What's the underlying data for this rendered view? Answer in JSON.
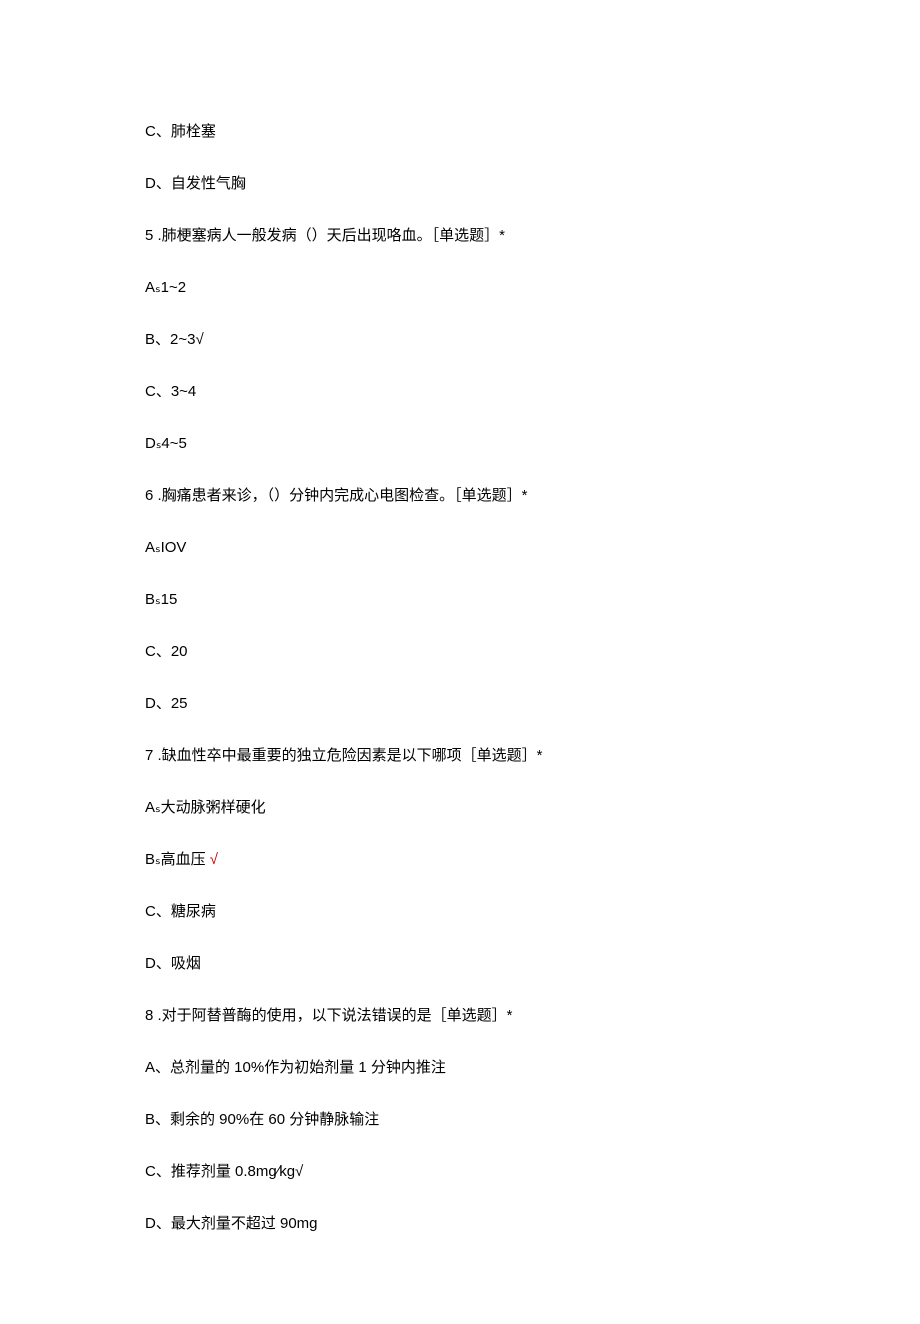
{
  "lines": {
    "optC4": "C、肺栓塞",
    "optD4": "D、自发性气胸",
    "q5": "5 .肺梗塞病人一般发病（）天后出现咯血。［单选题］*",
    "q5a": "Aₛ1~2",
    "q5b": "B、2~3√",
    "q5c": "C、3~4",
    "q5d": "Dₛ4~5",
    "q6": "6 .胸痛患者来诊，（）分钟内完成心电图检查。［单选题］*",
    "q6a": "AₛIOV",
    "q6b": "Bₛ15",
    "q6c": "C、20",
    "q6d": "D、25",
    "q7": "7 .缺血性卒中最重要的独立危险因素是以下哪项［单选题］*",
    "q7a": "Aₛ大动脉粥样硬化",
    "q7b_prefix": "Bₛ高血压 ",
    "q7b_check": "√",
    "q7c": "C、糖尿病",
    "q7d": "D、吸烟",
    "q8": "8 .对于阿替普酶的使用，以下说法错误的是［单选题］*",
    "q8a": "A、总剂量的 10%作为初始剂量 1 分钟内推注",
    "q8b": "B、剩余的 90%在 60 分钟静脉输注",
    "q8c": "C、推荐剂量 0.8mg⁄kg√",
    "q8d": "D、最大剂量不超过 90mg"
  }
}
